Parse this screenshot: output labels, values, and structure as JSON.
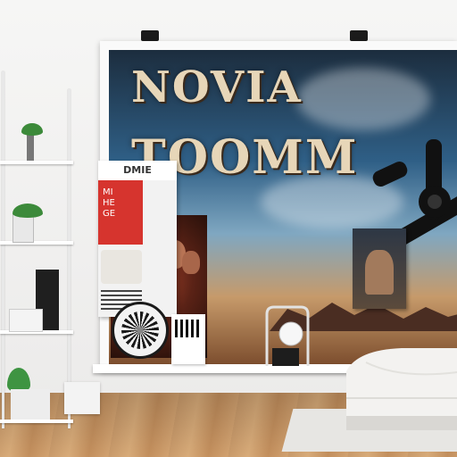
{
  "poster": {
    "title_line_1": "NOVIA",
    "title_line_2": "TOOMM"
  },
  "books": {
    "top_label": "DMIE",
    "red_text": "MI\nHE\nGE"
  },
  "colors": {
    "poster_sky_top": "#1c2d3e",
    "poster_sky_mid": "#2f5f86",
    "title_color": "#e7d6b8",
    "red_book": "#d6342e",
    "plant_green": "#3c8a3a",
    "floor_wood": "#c99a6a"
  },
  "icons": [
    "gear-wheel-icon",
    "clip-icon",
    "badge-icon",
    "lamp-icon",
    "plant-icon"
  ]
}
